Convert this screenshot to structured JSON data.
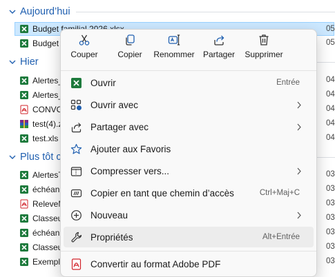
{
  "groups": [
    {
      "label": "Aujourd’hui"
    },
    {
      "label": "Hier"
    },
    {
      "label": "Plus tôt c"
    }
  ],
  "files": [
    {
      "name": "Budget familial 2026.xlsx",
      "date": "05,",
      "icon": "excel-icon"
    },
    {
      "name": "Budget",
      "date": "05,",
      "icon": "excel-icon"
    },
    {
      "name": "Alertes_",
      "date": "04,",
      "icon": "excel-icon"
    },
    {
      "name": "Alertes_",
      "date": "04,",
      "icon": "excel-icon"
    },
    {
      "name": "CONVO",
      "date": "04,",
      "icon": "pdf-icon"
    },
    {
      "name": "test(4).z",
      "date": "04,",
      "icon": "archive-icon"
    },
    {
      "name": "test.xls",
      "date": "04,",
      "icon": "excel-icon"
    },
    {
      "name": "AlertesT",
      "date": "03,",
      "icon": "excel-icon"
    },
    {
      "name": "échéan",
      "date": "03,",
      "icon": "excel-icon"
    },
    {
      "name": "ReleveM",
      "date": "03,",
      "icon": "pdf-icon"
    },
    {
      "name": "Classeu",
      "date": "03,",
      "icon": "excel-icon"
    },
    {
      "name": "échéan",
      "date": "03,",
      "icon": "excel-icon"
    },
    {
      "name": "Classeu",
      "date": "03,",
      "icon": "excel-icon"
    },
    {
      "name": "Exempl",
      "date": "03,",
      "icon": "excel-icon"
    }
  ],
  "menu": {
    "toolbar": [
      {
        "label": "Couper",
        "icon": "scissors-icon"
      },
      {
        "label": "Copier",
        "icon": "copy-icon"
      },
      {
        "label": "Renommer",
        "icon": "rename-icon"
      },
      {
        "label": "Partager",
        "icon": "share-icon"
      },
      {
        "label": "Supprimer",
        "icon": "trash-icon"
      }
    ],
    "items": [
      {
        "label": "Ouvrir",
        "shortcut": "Entrée",
        "icon": "excel-icon"
      },
      {
        "label": "Ouvrir avec",
        "icon": "open-with-icon",
        "submenu": true
      },
      {
        "label": "Partager avec",
        "icon": "share-with-icon",
        "submenu": true
      },
      {
        "label": "Ajouter aux Favoris",
        "icon": "star-icon"
      },
      {
        "label": "Compresser vers...",
        "icon": "archive-folder-icon",
        "submenu": true
      },
      {
        "label": "Copier en tant que chemin d’accès",
        "shortcut": "Ctrl+Maj+C",
        "icon": "copy-path-icon"
      },
      {
        "label": "Nouveau",
        "icon": "plus-circle-icon",
        "submenu": true
      },
      {
        "label": "Propriétés",
        "shortcut": "Alt+Entrée",
        "icon": "wrench-icon"
      },
      {
        "label": "Convertir au format Adobe PDF",
        "icon": "adobe-pdf-icon"
      }
    ]
  },
  "colors": {
    "accent": "#1f5fb0",
    "selection": "#cce8ff",
    "excel": "#1d7a3c",
    "pdf": "#d1232a",
    "menu_bg": "#f9f9f9"
  }
}
